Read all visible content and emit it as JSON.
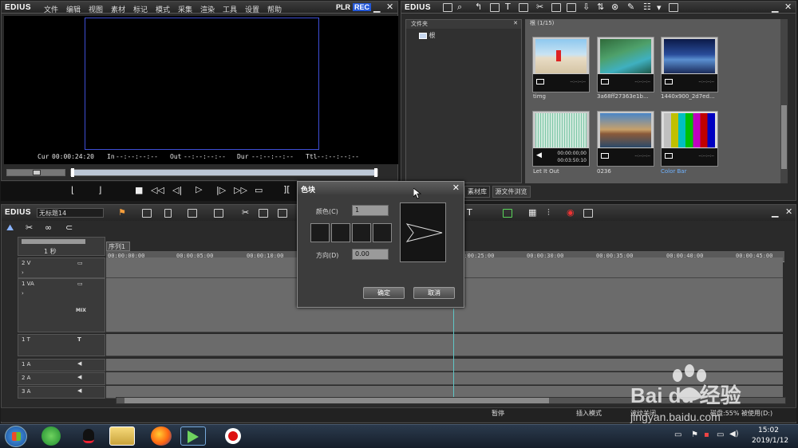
{
  "app": {
    "name": "EDIUS"
  },
  "menu": [
    "文件",
    "编辑",
    "视图",
    "素材",
    "标记",
    "模式",
    "采集",
    "渲染",
    "工具",
    "设置",
    "帮助"
  ],
  "player": {
    "mode_plr": "PLR",
    "mode_rec": "REC",
    "cur_label": "Cur",
    "cur_value": "00:00:24:20",
    "in_label": "In",
    "in_value": "--:--:--:--",
    "out_label": "Out",
    "out_value": "--:--:--:--",
    "dur_label": "Dur",
    "dur_value": "--:--:--:--",
    "ttl_label": "Ttl",
    "ttl_value": "--:--:--:--"
  },
  "bin": {
    "app_name": "EDIUS",
    "folder_header": "文件夹",
    "root_label": "根",
    "view_title": "根 (1/15)",
    "tab_library": "素材库",
    "tab_source": "源文件浏览",
    "clips": [
      {
        "name": "timg",
        "time": "--:--:--:--",
        "kind": "photo"
      },
      {
        "name": "3a68ff27363e1b...",
        "time": "--:--:--:--",
        "kind": "photo"
      },
      {
        "name": "1440x900_2d7ed...",
        "time": "--:--:--:--",
        "kind": "photo"
      },
      {
        "name": "Let It Out",
        "time1": "00:00:00;00",
        "time2": "00:03:50:10",
        "kind": "audio"
      },
      {
        "name": "0236",
        "time": "--:--:--:--",
        "kind": "photo"
      },
      {
        "name": "Color Bar",
        "time": "--:--:--:--",
        "kind": "colorbar"
      }
    ]
  },
  "timeline": {
    "project_label": "EDIUS",
    "project_name": "无标题14",
    "sequence_tab": "序列1",
    "scale_label": "1 秒",
    "ruler": [
      "00:00:00;00",
      "00:00:05;00",
      "00:00:10;00",
      "00:00:25;00",
      "00:00:30;00",
      "00:00:35;00",
      "00:00:40;00",
      "00:00:45;00"
    ],
    "tracks": [
      {
        "name": "2 V"
      },
      {
        "name": "1 VA",
        "extra": "MIX"
      },
      {
        "name": "1 T"
      },
      {
        "name": "1 A"
      },
      {
        "name": "2 A"
      },
      {
        "name": "3 A"
      }
    ]
  },
  "dialog": {
    "title": "色块",
    "color_label": "颜色(C)",
    "color_value": "1",
    "direction_label": "方向(D)",
    "direction_value": "0.00",
    "ok_label": "确定",
    "cancel_label": "取消"
  },
  "statusbar": {
    "pause": "暂停",
    "insert_mode": "插入模式",
    "ripple": "波纹关闭",
    "disk": "磁盘:55% 被使用(D:)"
  },
  "taskbar": {
    "time": "15:02",
    "date": "2019/1/12"
  },
  "watermark": {
    "brand": "Bai du 经验",
    "url": "jingyan.baidu.com"
  },
  "colors": {
    "accent": "#3e4fd6",
    "rec": "#2458d8",
    "playhead": "#5fc6c6"
  }
}
